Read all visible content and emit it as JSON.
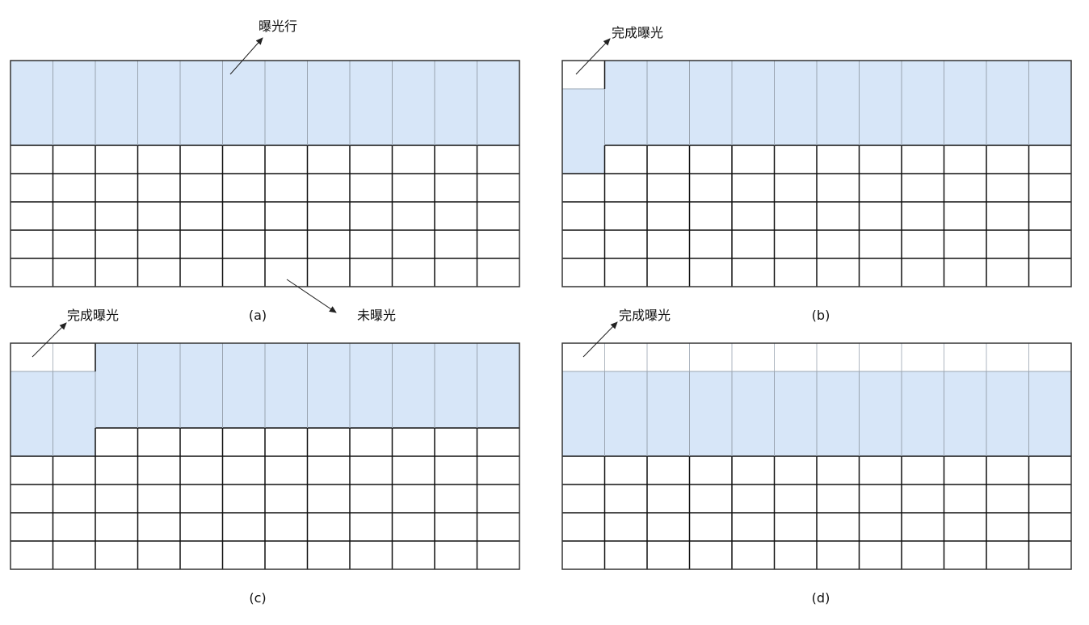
{
  "panels": [
    {
      "caption": "(a)",
      "exposing_rows": 3,
      "exposed_cells": 0,
      "cols": 12,
      "rows": 8,
      "annotations": [
        {
          "id": "exposing-row",
          "text": "曝光行"
        },
        {
          "id": "unexposed",
          "text": "未曝光"
        }
      ]
    },
    {
      "caption": "(b)",
      "exposing_rows": 3,
      "exposed_cells": 1,
      "cols": 12,
      "rows": 8,
      "annotations": [
        {
          "id": "exposure-done",
          "text": "完成曝光"
        }
      ]
    },
    {
      "caption": "(c)",
      "exposing_rows": 3,
      "exposed_cells": 2,
      "cols": 12,
      "rows": 8,
      "annotations": [
        {
          "id": "exposure-done",
          "text": "完成曝光"
        }
      ]
    },
    {
      "caption": "(d)",
      "exposing_rows": 3,
      "exposed_cells": 12,
      "cols": 12,
      "rows": 8,
      "annotations": [
        {
          "id": "exposure-done",
          "text": "完成曝光"
        }
      ]
    }
  ],
  "colors": {
    "exposing_fill": "#d7e6f8",
    "exposing_divider": "#9aa4b0",
    "grid_line": "#111111",
    "border": "#333333",
    "background": "#ffffff"
  }
}
